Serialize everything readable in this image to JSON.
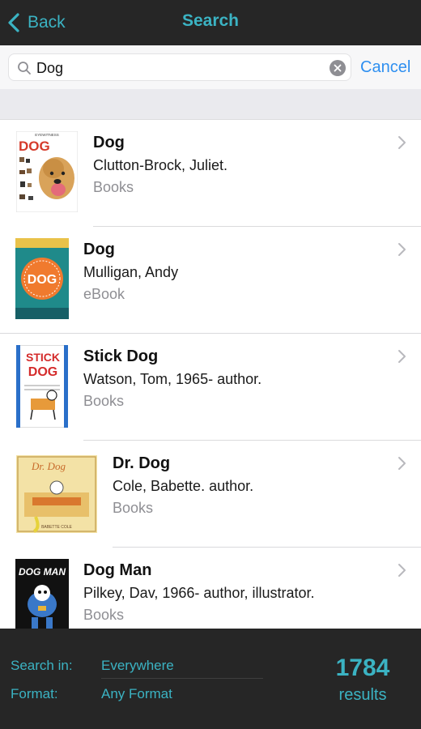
{
  "nav": {
    "back_label": "Back",
    "title": "Search"
  },
  "search": {
    "value": "Dog",
    "cancel_label": "Cancel"
  },
  "results": [
    {
      "title": "Dog",
      "author": "Clutton-Brock, Juliet.",
      "format": "Books",
      "cover_text": "DOG",
      "cover_small_text": "EYEWITNESS"
    },
    {
      "title": "Dog",
      "author": "Mulligan, Andy",
      "format": "eBook",
      "cover_text": "DOG"
    },
    {
      "title": "Stick Dog",
      "author": "Watson, Tom, 1965- author.",
      "format": "Books",
      "cover_text_1": "STICK",
      "cover_text_2": "DOG"
    },
    {
      "title": "Dr. Dog",
      "author": "Cole, Babette. author.",
      "format": "Books",
      "cover_text": "Dr. Dog",
      "cover_small_text": "BABETTE COLE"
    },
    {
      "title": "Dog Man",
      "author": "Pilkey, Dav, 1966- author, illustrator.",
      "format": "Books",
      "cover_text": "DOG MAN"
    }
  ],
  "footer": {
    "search_in_label": "Search in:",
    "search_in_value": "Everywhere",
    "format_label": "Format:",
    "format_value": "Any Format",
    "count": "1784",
    "count_label": "results"
  },
  "colors": {
    "accent": "#3bb3c3",
    "cancel": "#2e8ff0",
    "bar": "#262626"
  }
}
